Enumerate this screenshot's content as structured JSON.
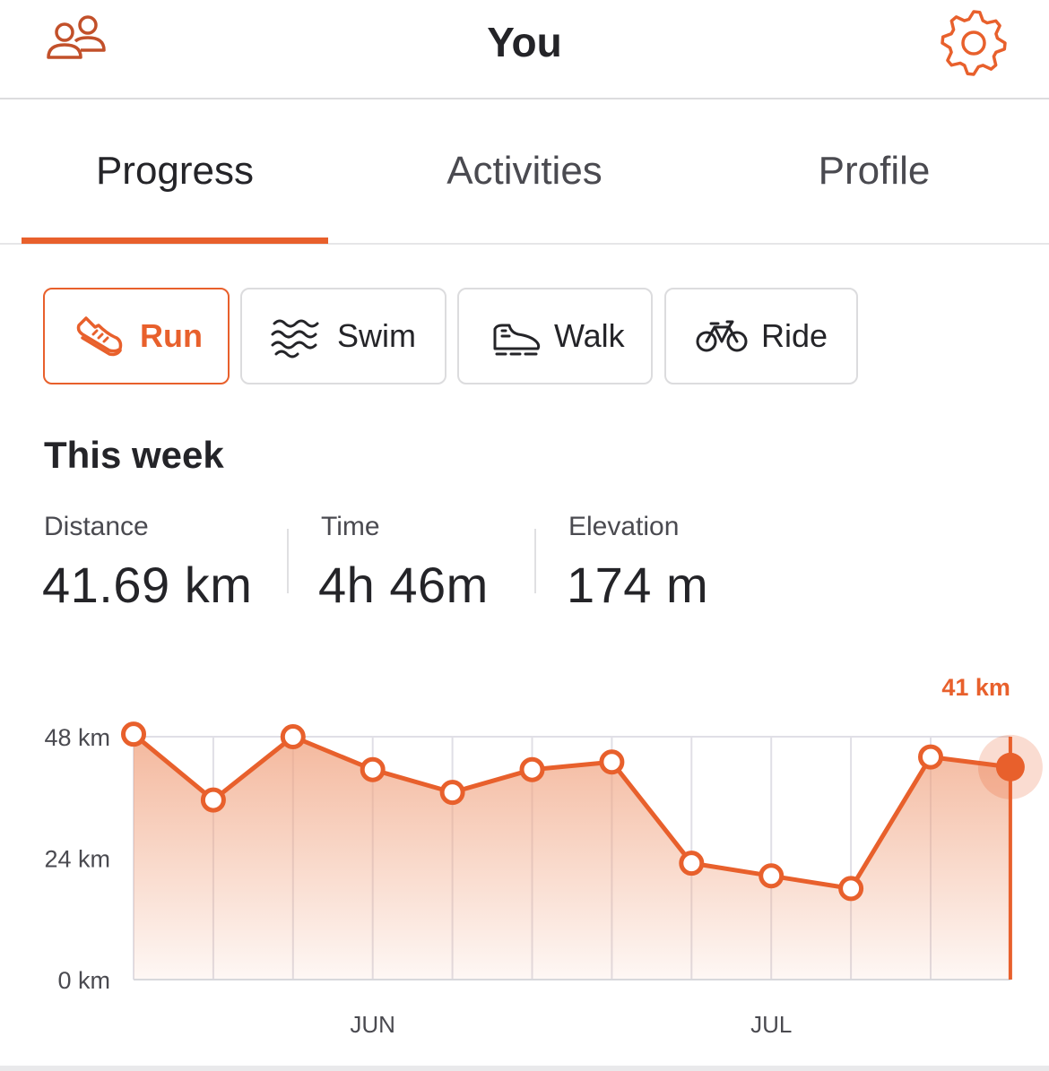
{
  "header": {
    "title": "You",
    "left_icon": "athletes-icon",
    "right_icon": "gear-icon"
  },
  "tabs": [
    {
      "label": "Progress",
      "active": true
    },
    {
      "label": "Activities",
      "active": false
    },
    {
      "label": "Profile",
      "active": false
    }
  ],
  "sports": [
    {
      "label": "Run",
      "icon": "running-shoe-icon",
      "active": true
    },
    {
      "label": "Swim",
      "icon": "waves-icon",
      "active": false
    },
    {
      "label": "Walk",
      "icon": "walking-shoe-icon",
      "active": false
    },
    {
      "label": "Ride",
      "icon": "bicycle-icon",
      "active": false
    }
  ],
  "summary": {
    "title": "This week",
    "stats": [
      {
        "label": "Distance",
        "value": "41.69 km"
      },
      {
        "label": "Time",
        "value": "4h 46m"
      },
      {
        "label": "Elevation",
        "value": "174 m"
      }
    ]
  },
  "colors": {
    "accent": "#e8602c",
    "text": "#242428",
    "muted": "#4a4a50",
    "grid": "#e0dfe6"
  },
  "chart_data": {
    "type": "area",
    "x": [
      "",
      "",
      "",
      "",
      "",
      "",
      "",
      "",
      "",
      "",
      "",
      ""
    ],
    "x_tick_labels": [
      {
        "index": 3,
        "label": "JUN"
      },
      {
        "index": 8,
        "label": "JUL"
      }
    ],
    "series": [
      {
        "values": [
          48.5,
          35.5,
          48,
          41.5,
          37,
          41.5,
          43,
          23,
          20.5,
          18,
          44,
          42
        ]
      }
    ],
    "y_ticks": [
      "0 km",
      "24 km",
      "48 km"
    ],
    "ylim": [
      0,
      48
    ],
    "highlight": {
      "index": 11,
      "label": "41 km"
    },
    "grid": true
  }
}
